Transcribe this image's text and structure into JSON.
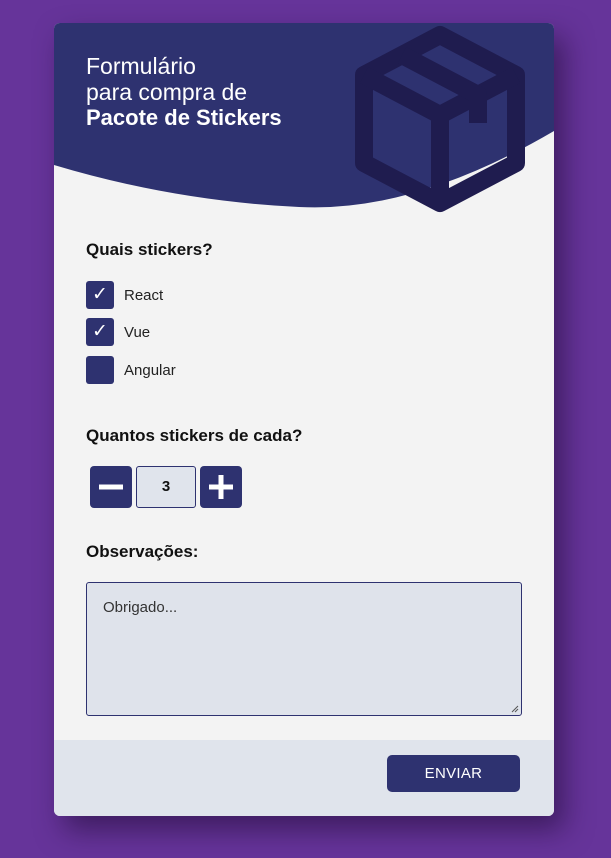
{
  "header": {
    "title_line1": "Formulário",
    "title_line2": "para compra de",
    "title_line3": "Pacote de Stickers",
    "icon": "package-box-icon"
  },
  "stickers": {
    "label": "Quais stickers?",
    "options": [
      {
        "label": "React",
        "checked": true
      },
      {
        "label": "Vue",
        "checked": true
      },
      {
        "label": "Angular",
        "checked": false
      }
    ]
  },
  "quantity": {
    "label": "Quantos stickers de cada?",
    "value": "3",
    "decrement_icon": "minus-icon",
    "increment_icon": "plus-icon"
  },
  "notes": {
    "label": "Observações:",
    "placeholder": "Obrigado..."
  },
  "footer": {
    "submit_label": "ENVIAR"
  },
  "colors": {
    "background": "#66349a",
    "primary": "#2e3270",
    "card": "#f3f3f3",
    "footer": "#e0e4ec"
  }
}
